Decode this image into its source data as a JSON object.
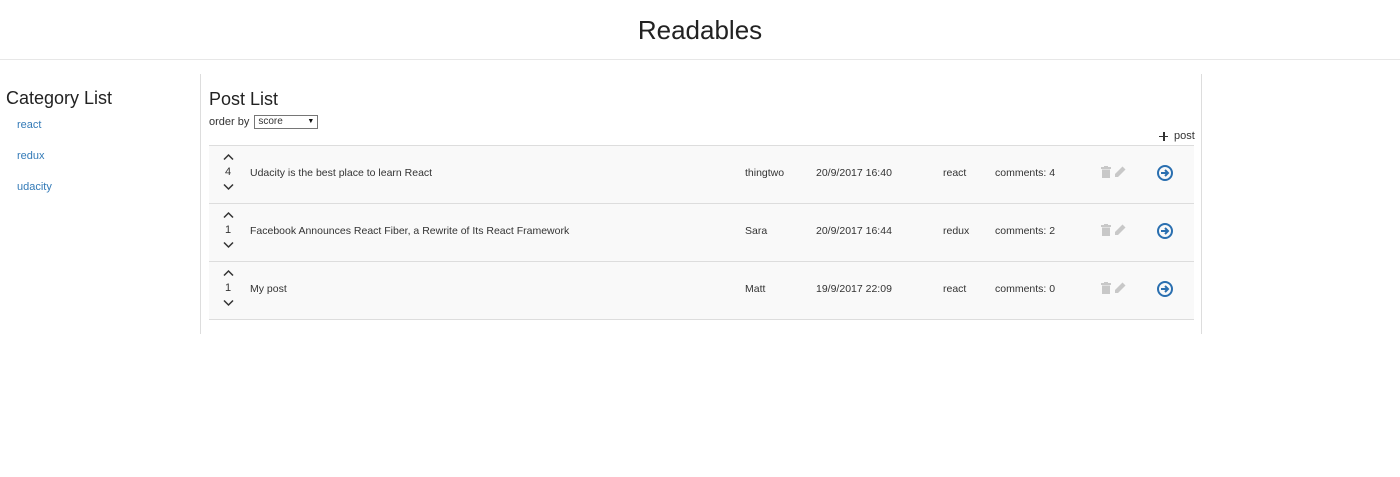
{
  "app": {
    "title": "Readables"
  },
  "sidebar": {
    "heading": "Category List",
    "categories": [
      {
        "label": "react"
      },
      {
        "label": "redux"
      },
      {
        "label": "udacity"
      }
    ]
  },
  "main": {
    "heading": "Post List",
    "order_label": "order by",
    "order_selected": "score",
    "add_post_label": "post",
    "posts": [
      {
        "score": "4",
        "title": "Udacity is the best place to learn React",
        "author": "thingtwo",
        "date": "20/9/2017 16:40",
        "category": "react",
        "comments": "comments: 4"
      },
      {
        "score": "1",
        "title": "Facebook Announces React Fiber, a Rewrite of Its React Framework",
        "author": "Sara",
        "date": "20/9/2017 16:44",
        "category": "redux",
        "comments": "comments: 2"
      },
      {
        "score": "1",
        "title": "My post",
        "author": "Matt",
        "date": "19/9/2017 22:09",
        "category": "react",
        "comments": "comments: 0"
      }
    ]
  },
  "icons": {
    "up": "chevron-up-icon",
    "down": "chevron-down-icon",
    "delete": "trash-icon",
    "edit": "pencil-icon",
    "open": "arrow-circle-right-icon",
    "add": "plus-icon"
  },
  "colors": {
    "link": "#337ab7",
    "open_icon": "#2a6fb0",
    "muted_icon": "#c8c8c8"
  }
}
